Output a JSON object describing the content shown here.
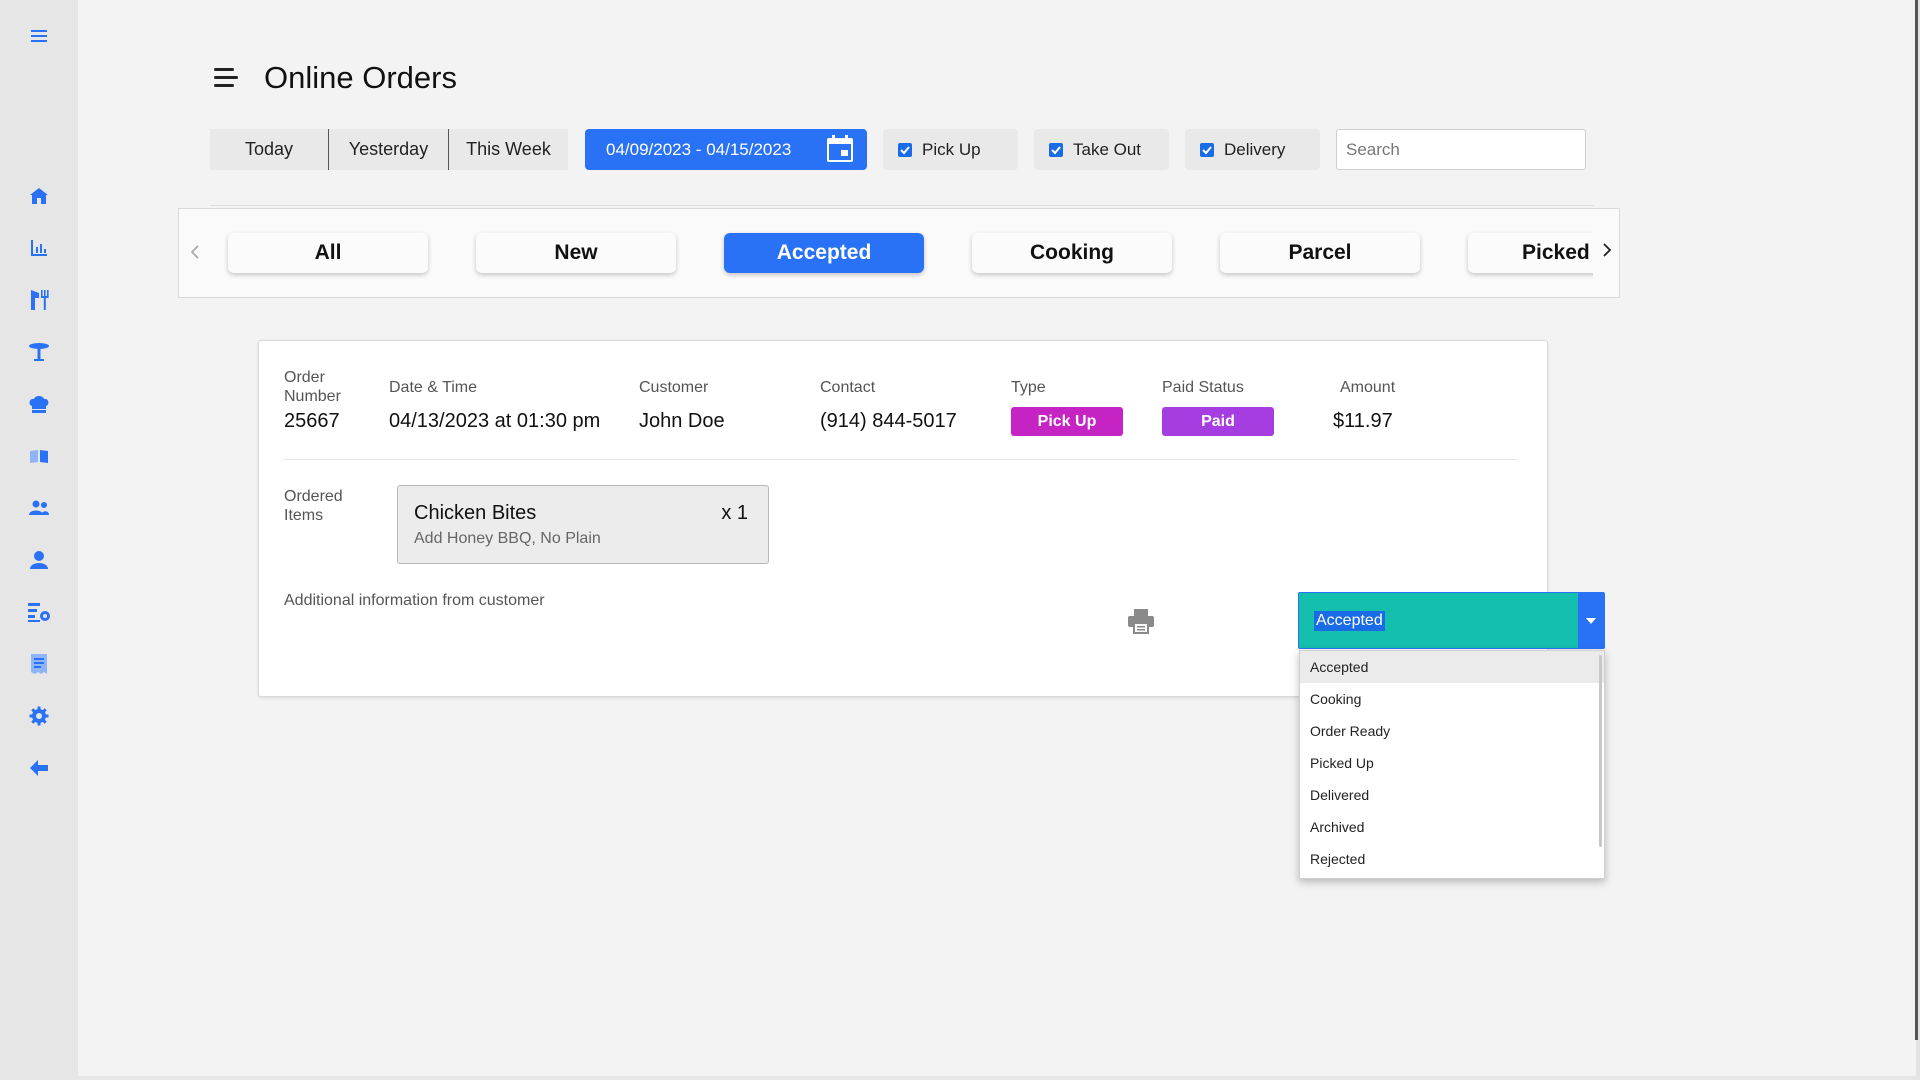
{
  "page": {
    "title": "Online Orders"
  },
  "sidebar": {
    "items": [
      {
        "icon": "menu-icon"
      },
      {
        "icon": "home-icon"
      },
      {
        "icon": "bar-chart-icon"
      },
      {
        "icon": "restaurant-icon"
      },
      {
        "icon": "dining-table-icon"
      },
      {
        "icon": "chef-hat-icon"
      },
      {
        "icon": "menu-book-icon"
      },
      {
        "icon": "group-icon"
      },
      {
        "icon": "person-icon"
      },
      {
        "icon": "list-settings-icon"
      },
      {
        "icon": "receipt-icon"
      },
      {
        "icon": "settings-gear-icon"
      },
      {
        "icon": "back-arrow-icon"
      }
    ]
  },
  "toolbar": {
    "periods": [
      "Today",
      "Yesterday",
      "This Week"
    ],
    "date_range": "04/09/2023 - 04/15/2023",
    "filters": [
      "Pick Up",
      "Take Out",
      "Delivery"
    ],
    "search_placeholder": "Search"
  },
  "tabs": [
    "All",
    "New",
    "Accepted",
    "Cooking",
    "Parcel",
    "Picked U"
  ],
  "active_tab": "Accepted",
  "order": {
    "labels": {
      "order_number_l1": "Order",
      "order_number_l2": "Number",
      "date_time": "Date & Time",
      "customer": "Customer",
      "contact": "Contact",
      "type": "Type",
      "paid_status": "Paid Status",
      "amount": "Amount",
      "ordered_l1": "Ordered",
      "ordered_l2": "Items",
      "additional_info": "Additional information from customer"
    },
    "order_number": "25667",
    "date_time": "04/13/2023 at 01:30 pm",
    "customer": "John Doe",
    "contact": "(914) 844-5017",
    "type": "Pick Up",
    "paid_status": "Paid",
    "amount": "$11.97",
    "item": {
      "name": "Chicken Bites",
      "qty": "x 1",
      "modifiers": "Add Honey BBQ, No Plain"
    }
  },
  "status_select": {
    "selected": "Accepted",
    "options": [
      "Accepted",
      "Cooking",
      "Order Ready",
      "Picked Up",
      "Delivered",
      "Archived",
      "Rejected"
    ]
  },
  "colors": {
    "accent": "#2a72f5",
    "type_badge": "#c623c4",
    "paid_badge": "#a53de0",
    "select_bg": "#15bfae"
  }
}
